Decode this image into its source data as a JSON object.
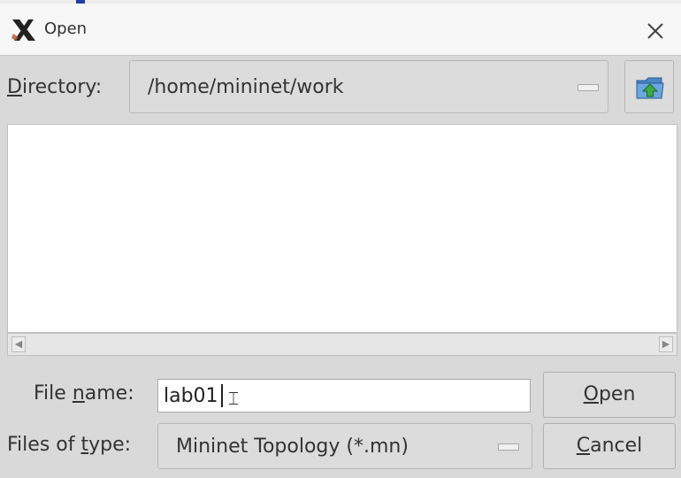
{
  "window": {
    "title": "Open"
  },
  "directory": {
    "label_mnemonic": "D",
    "label_rest": "irectory:",
    "value": "/home/mininet/work",
    "up_button_icon": "folder-up-icon"
  },
  "file_list": {
    "items": []
  },
  "file_name": {
    "label_before": "File ",
    "label_mnemonic": "n",
    "label_after": "ame:",
    "value": "lab01"
  },
  "files_of_type": {
    "label_before": "Files of ",
    "label_mnemonic": "t",
    "label_after": "ype:",
    "value": "Mininet Topology (*.mn)"
  },
  "buttons": {
    "open_mnemonic": "O",
    "open_rest": "pen",
    "cancel_mnemonic": "C",
    "cancel_rest": "ancel"
  },
  "colors": {
    "background": "#d9d9d9",
    "titlebar": "#f7f7f7",
    "folder_icon": "#4a86c8",
    "up_arrow": "#3fa64a"
  }
}
